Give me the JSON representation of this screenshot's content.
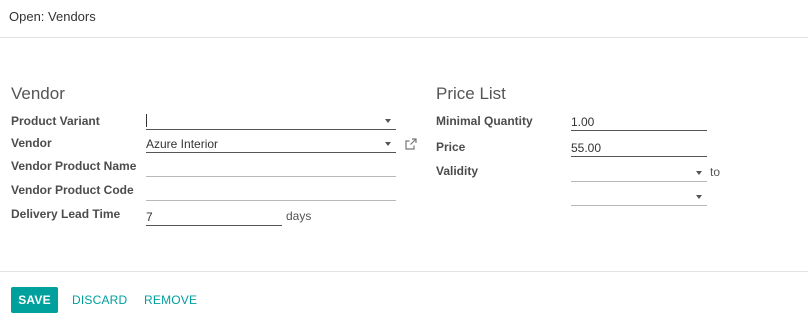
{
  "modal": {
    "title": "Open: Vendors"
  },
  "vendor_section": {
    "title": "Vendor",
    "product_variant": {
      "label": "Product Variant",
      "value": ""
    },
    "vendor": {
      "label": "Vendor",
      "value": "Azure Interior"
    },
    "vendor_product_name": {
      "label": "Vendor Product Name",
      "value": ""
    },
    "vendor_product_code": {
      "label": "Vendor Product Code",
      "value": ""
    },
    "delivery_lead_time": {
      "label": "Delivery Lead Time",
      "value": "7",
      "suffix": "days"
    }
  },
  "price_section": {
    "title": "Price List",
    "minimal_quantity": {
      "label": "Minimal Quantity",
      "value": "1.00"
    },
    "price": {
      "label": "Price",
      "value": "55.00"
    },
    "validity": {
      "label": "Validity",
      "start": "",
      "end": "",
      "to_label": "to"
    }
  },
  "footer": {
    "save_label": "SAVE",
    "discard_label": "DISCARD",
    "remove_label": "REMOVE"
  },
  "colors": {
    "accent": "#00a09d",
    "text": "#4c4c4c"
  },
  "icons": {
    "external_link": "external-link-icon",
    "dropdown": "caret-down-icon"
  }
}
